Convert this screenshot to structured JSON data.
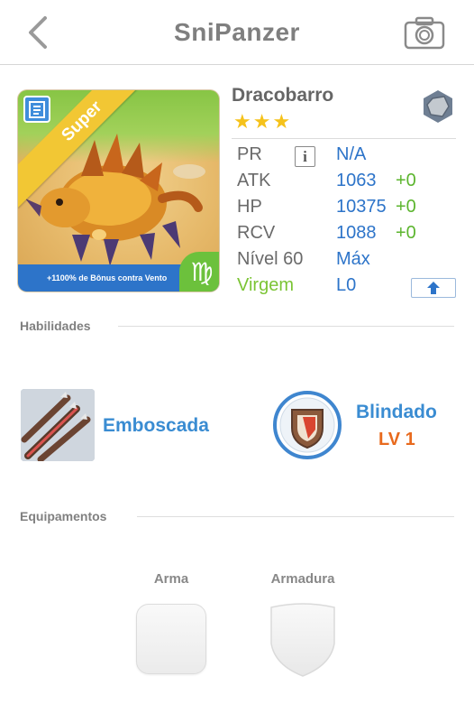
{
  "header": {
    "title": "SniPanzer",
    "back_icon": "chevron-left-icon",
    "camera_icon": "camera-icon"
  },
  "monster": {
    "name": "Dracobarro",
    "stars": "★★★",
    "star_count": 3,
    "rarity_ribbon": "Super",
    "bonus_text": "+1100% de Bônus contra Vento",
    "zodiac_symbol": "♍",
    "element_icon": "rock-element-icon",
    "card_type_icon": "card-icon"
  },
  "stats": {
    "pr": {
      "label": "PR",
      "value": "N/A"
    },
    "atk": {
      "label": "ATK",
      "value": "1063",
      "bonus": "+0"
    },
    "hp": {
      "label": "HP",
      "value": "10375",
      "bonus": "+0"
    },
    "rcv": {
      "label": "RCV",
      "value": "1088",
      "bonus": "+0"
    },
    "level": {
      "label": "Nível 60",
      "value": "Máx"
    },
    "zodiac": {
      "label": "Virgem",
      "value": "L0"
    }
  },
  "sections": {
    "skills_title": "Habilidades",
    "equipment_title": "Equipamentos"
  },
  "skills": {
    "active": {
      "name": "Emboscada",
      "icon": "arrows-icon"
    },
    "ability": {
      "name": "Blindado",
      "level": "LV 1",
      "icon": "shield-ability-icon"
    }
  },
  "equipment": {
    "weapon_label": "Arma",
    "armor_label": "Armadura"
  },
  "colors": {
    "accent_blue": "#2d74c9",
    "bonus_green": "#5cb52e",
    "zodiac_green": "#7bc434",
    "level_orange": "#e86a1e",
    "star_yellow": "#f5c21b"
  }
}
